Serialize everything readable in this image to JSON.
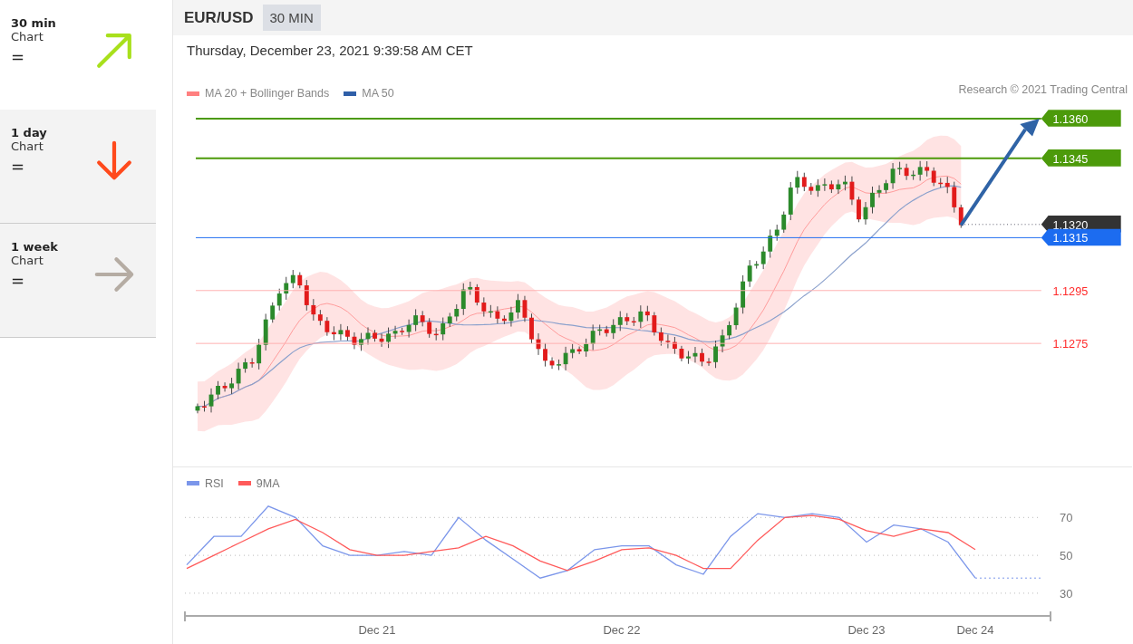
{
  "sidebar": {
    "items": [
      {
        "title": "30 min",
        "subtitle": "Chart",
        "symbol": "=",
        "kind": "up",
        "color": "#a8e01c",
        "selected": true
      },
      {
        "title": "1 day",
        "subtitle": "Chart",
        "symbol": "=",
        "kind": "down",
        "color": "#ff4a1c",
        "selected": false
      },
      {
        "title": "1 week",
        "subtitle": "Chart",
        "symbol": "=",
        "kind": "right",
        "color": "#b5aca3",
        "selected": false
      }
    ]
  },
  "header": {
    "symbol": "EUR/USD",
    "interval": "30 MIN"
  },
  "timestamp": "Thursday, December 23, 2021 9:39:58 AM CET",
  "legend": [
    {
      "label": "MA 20 + Bollinger Bands",
      "color": "#ff8080"
    },
    {
      "label": "MA 50",
      "color": "#2f5fa8"
    }
  ],
  "credit": "Research © 2021 Trading Central",
  "levels": [
    {
      "price": "1.1360",
      "kind": "tag",
      "color": "#4c9a0a"
    },
    {
      "price": "1.1345",
      "kind": "tag",
      "color": "#4c9a0a"
    },
    {
      "price": "1.1320",
      "kind": "tag",
      "color": "#333333"
    },
    {
      "price": "1.1315",
      "kind": "tag",
      "color": "#1c6cf0"
    },
    {
      "price": "1.1295",
      "kind": "text",
      "color": "#ff2a2a"
    },
    {
      "price": "1.1275",
      "kind": "text",
      "color": "#ff2a2a"
    }
  ],
  "rsi": {
    "chart_data": {
      "type": "line",
      "categories": [
        null,
        null,
        null,
        null,
        null,
        null,
        null,
        "Dec 21",
        null,
        null,
        null,
        null,
        null,
        null,
        null,
        null,
        "Dec 22",
        null,
        null,
        null,
        null,
        null,
        null,
        null,
        null,
        "Dec 23",
        null,
        null,
        null,
        "Dec 24"
      ],
      "series": [
        {
          "name": "RSI",
          "color": "#7b96ea",
          "values": [
            45,
            60,
            60,
            76,
            70,
            55,
            50,
            50,
            52,
            50,
            70,
            58,
            48,
            38,
            42,
            53,
            55,
            55,
            45,
            40,
            60,
            72,
            70,
            72,
            70,
            57,
            66,
            64,
            57,
            38
          ]
        },
        {
          "name": "9MA",
          "color": "#ff5a5a",
          "values": [
            43,
            50,
            57,
            64,
            69,
            62,
            53,
            50,
            50,
            52,
            54,
            60,
            55,
            47,
            42,
            47,
            53,
            54,
            50,
            43,
            43,
            58,
            70,
            71,
            69,
            63,
            60,
            64,
            62,
            53
          ]
        }
      ],
      "grid": true,
      "ylim": [
        18,
        96.7
      ],
      "yticks": [
        30,
        50,
        70
      ]
    }
  }
}
